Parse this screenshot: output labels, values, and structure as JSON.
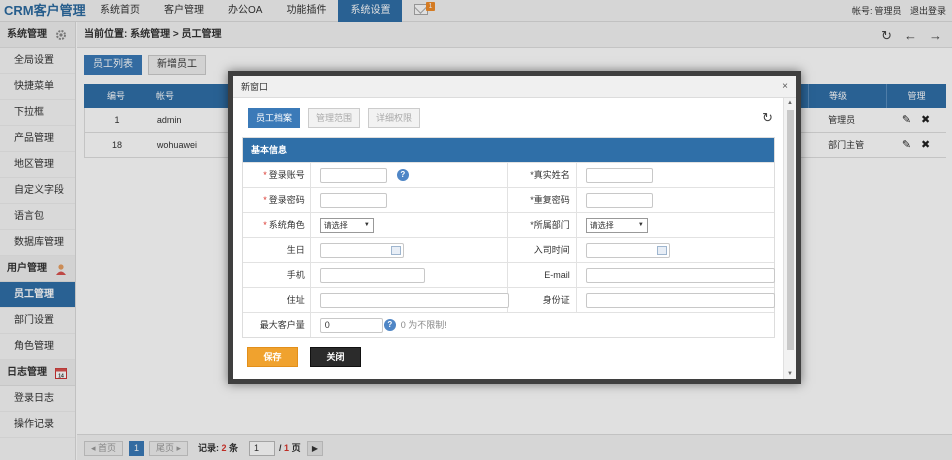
{
  "brand": "CRM客户管理",
  "nav": [
    "系统首页",
    "客户管理",
    "办公OA",
    "功能插件",
    "系统设置"
  ],
  "mail_badge": "1",
  "user": {
    "account_label": "帐号:",
    "account_name": "管理员",
    "logout": "退出登录"
  },
  "sidebar": {
    "groups": [
      {
        "title": "系统管理",
        "icon": "gear-icon",
        "items": [
          "全局设置",
          "快捷菜单",
          "下拉框",
          "产品管理",
          "地区管理",
          "自定义字段",
          "语言包",
          "数据库管理"
        ]
      },
      {
        "title": "用户管理",
        "icon": "user-icon",
        "items": [
          "员工管理",
          "部门设置",
          "角色管理"
        ]
      },
      {
        "title": "日志管理",
        "icon": "calendar-icon",
        "items": [
          "登录日志",
          "操作记录"
        ]
      }
    ],
    "active": "员工管理"
  },
  "breadcrumb": "当前位置: 系统管理 > 员工管理",
  "tabs": [
    "员工列表",
    "新增员工"
  ],
  "table": {
    "headers": [
      "编号",
      "帐号",
      "等级",
      "管理"
    ],
    "rows": [
      {
        "id": "1",
        "account": "admin",
        "level": "管理员"
      },
      {
        "id": "18",
        "account": "wohuawei",
        "level": "部门主管"
      }
    ]
  },
  "pager": {
    "first": "首页",
    "current": "1",
    "last": "尾页",
    "records_label": "记录:",
    "records_count": "2",
    "records_unit": "条",
    "page_input": "1",
    "page_sep": "/",
    "page_total": "1",
    "page_unit": "页"
  },
  "modal": {
    "title": "新窗口",
    "close": "×",
    "tabs": [
      "员工档案",
      "管理范围",
      "详细权限"
    ],
    "section_title": "基本信息",
    "fields": {
      "login_account": "登录账号",
      "real_name": "真实姓名",
      "login_password": "登录密码",
      "repeat_password": "重复密码",
      "system_role": "系统角色",
      "department": "所属部门",
      "select_placeholder": "请选择",
      "birthday": "生日",
      "join_date": "入司时间",
      "mobile": "手机",
      "email": "E-mail",
      "address": "住址",
      "id_card": "身份证",
      "max_customers": "最大客户量",
      "max_customers_value": "0",
      "max_customers_hint": "0 为不限制!"
    },
    "save_label": "保存",
    "close_label": "关闭"
  }
}
